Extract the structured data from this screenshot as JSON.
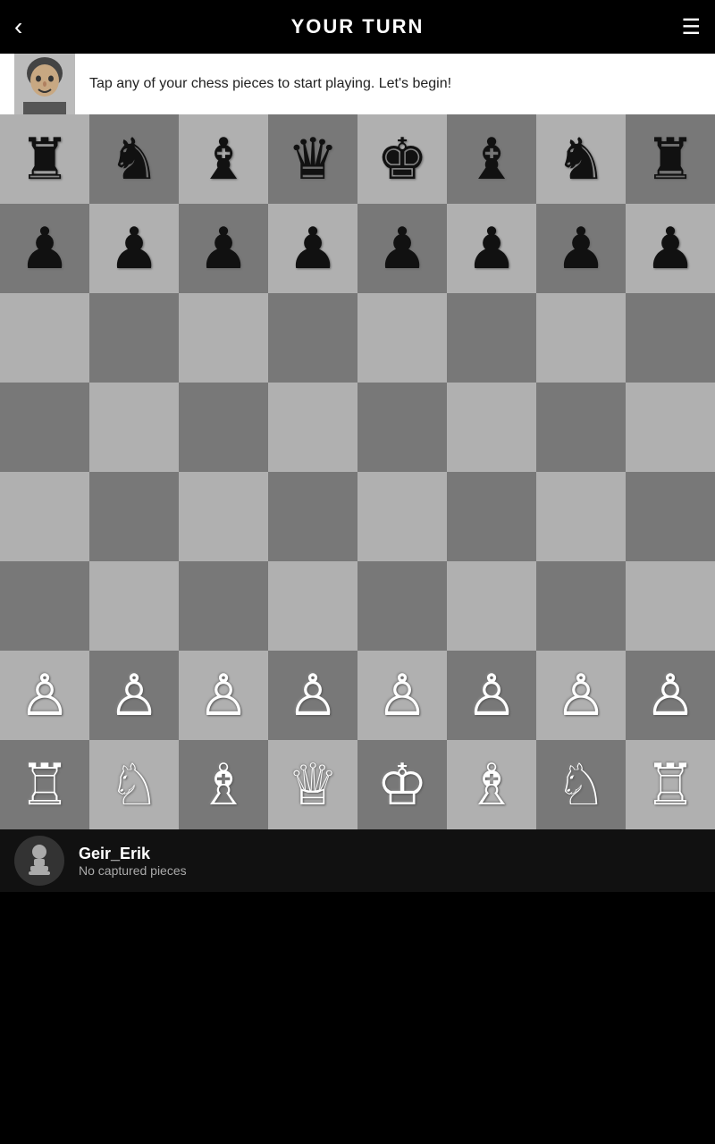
{
  "header": {
    "title": "YOUR TURN",
    "back_label": "‹",
    "menu_label": "☰"
  },
  "tooltip": {
    "message": "Tap any of your chess pieces to start playing. Let's begin!"
  },
  "board": {
    "rows": [
      [
        "br",
        "bn",
        "bb",
        "bq",
        "bk",
        "bb",
        "bn",
        "br"
      ],
      [
        "bp",
        "bp",
        "bp",
        "bp",
        "bp",
        "bp",
        "bp",
        "bp"
      ],
      [
        "",
        "",
        "",
        "",
        "",
        "",
        "",
        ""
      ],
      [
        "",
        "",
        "",
        "",
        "",
        "",
        "",
        ""
      ],
      [
        "",
        "",
        "",
        "",
        "",
        "",
        "",
        ""
      ],
      [
        "",
        "",
        "",
        "",
        "",
        "",
        "",
        ""
      ],
      [
        "wp",
        "wp",
        "wp",
        "wp",
        "wp",
        "wp",
        "wp",
        "wp"
      ],
      [
        "wr",
        "wn",
        "wb",
        "wq",
        "wk",
        "wb",
        "wn",
        "wr"
      ]
    ]
  },
  "player": {
    "name": "Geir_Erik",
    "captured": "No captured pieces"
  },
  "pieces": {
    "br": "♜",
    "bn": "♞",
    "bb": "♝",
    "bq": "♛",
    "bk": "♚",
    "bp": "♟",
    "wr": "♖",
    "wn": "♘",
    "wb": "♗",
    "wq": "♕",
    "wk": "♔",
    "wp": "♙"
  }
}
